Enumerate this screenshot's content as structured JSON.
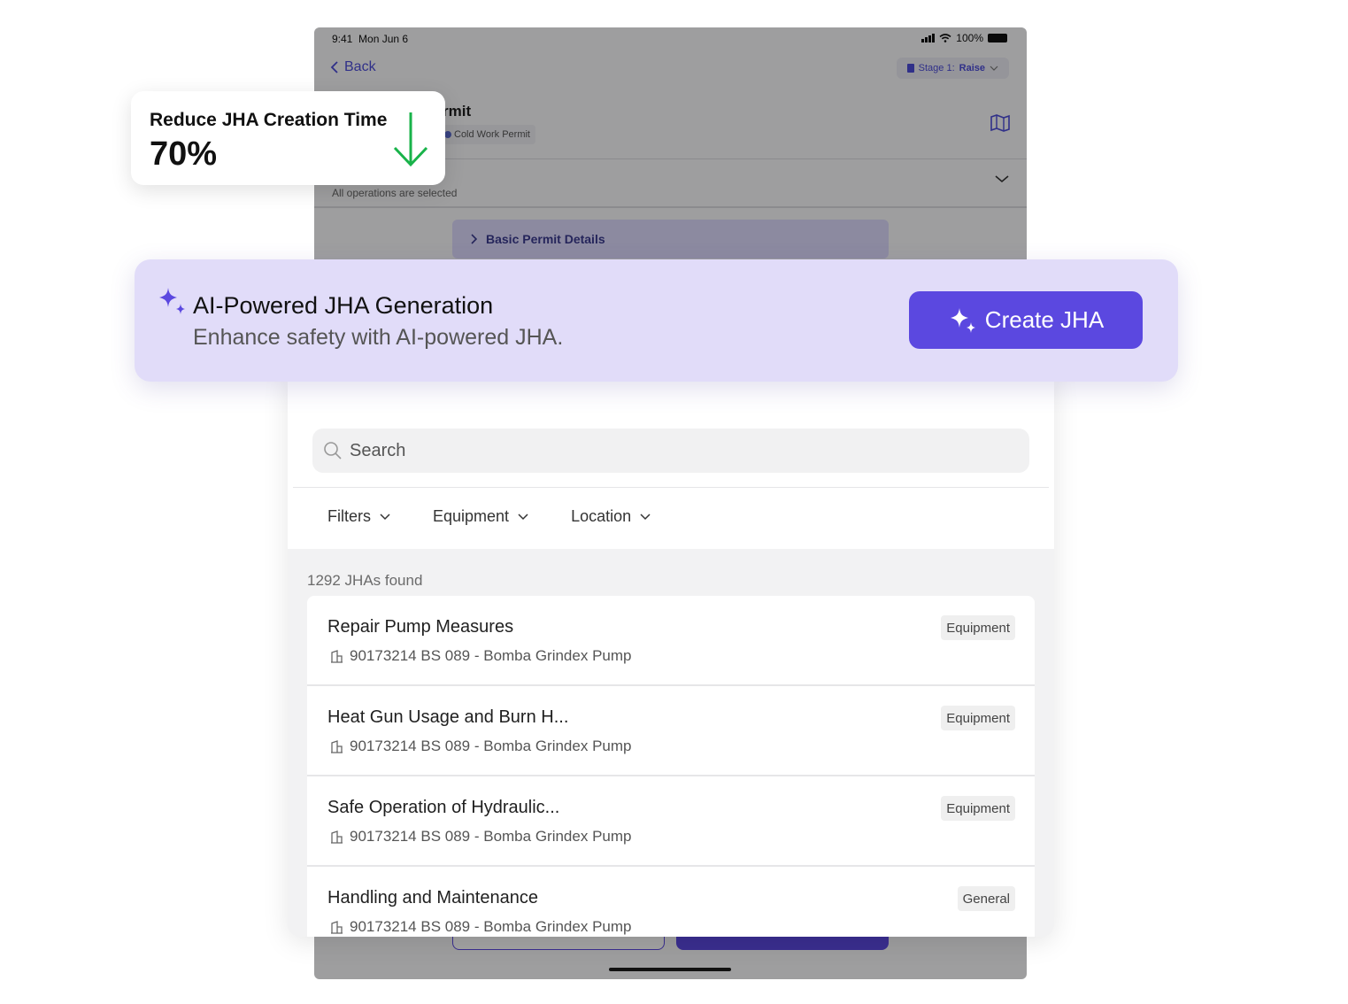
{
  "colors": {
    "accent": "#5b48e0",
    "banner_bg": "#e1dcf9",
    "arrow_green": "#19b34a"
  },
  "tablet": {
    "status_time": "9:41",
    "status_date": "Mon Jun 6",
    "battery": "100%",
    "back_label": "Back",
    "stage_prefix": "Stage 1:",
    "stage_value": "Raise",
    "permit_title_visible": "rmit",
    "permit_type": "Cold Work Permit",
    "operations_text": "All operations are selected",
    "section_label": "Basic Permit Details"
  },
  "stat_card": {
    "title": "Reduce JHA Creation Time",
    "value": "70%",
    "arrow_icon": "arrow-down-icon"
  },
  "ai_banner": {
    "title": "AI-Powered JHA Generation",
    "subtitle": "Enhance safety with AI-powered JHA.",
    "button_label": "Create JHA",
    "icon": "sparkle-icon"
  },
  "jha_list": {
    "search_placeholder": "Search",
    "filters": [
      {
        "label": "Filters"
      },
      {
        "label": "Equipment"
      },
      {
        "label": "Location"
      }
    ],
    "found_text": "1292 JHAs found",
    "items": [
      {
        "title": "Repair Pump Measures",
        "subtitle": "90173214 BS 089 - Bomba Grindex Pump",
        "tag": "Equipment"
      },
      {
        "title": "Heat Gun Usage and Burn H...",
        "subtitle": "90173214 BS 089 - Bomba Grindex Pump",
        "tag": "Equipment"
      },
      {
        "title": "Safe Operation of Hydraulic...",
        "subtitle": "90173214 BS 089 - Bomba Grindex Pump",
        "tag": "Equipment"
      },
      {
        "title": "Handling and Maintenance",
        "subtitle": "90173214 BS 089 - Bomba Grindex Pump",
        "tag": "General"
      }
    ]
  }
}
